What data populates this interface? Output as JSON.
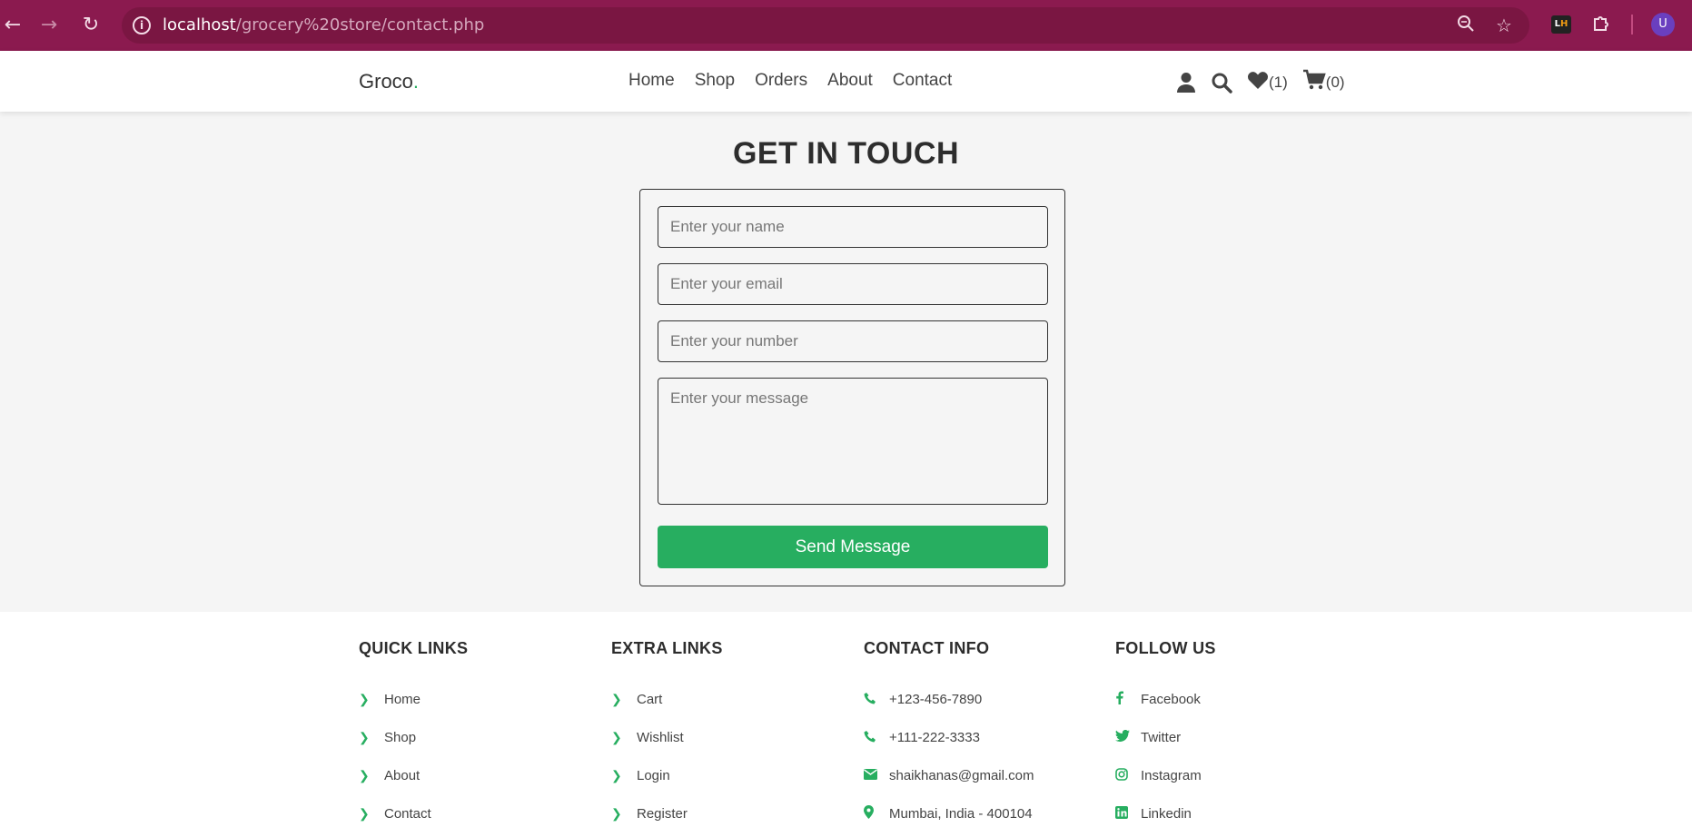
{
  "browser": {
    "url_host": "localhost",
    "url_path": "/grocery%20store/contact.php",
    "profile_initial": "U"
  },
  "header": {
    "logo": "Groco",
    "logo_dot": ".",
    "menu": [
      {
        "label": "Home"
      },
      {
        "label": "Shop"
      },
      {
        "label": "Orders"
      },
      {
        "label": "About"
      },
      {
        "label": "Contact"
      }
    ],
    "wishlist_count": "(1)",
    "cart_count": "(0)"
  },
  "contact": {
    "heading": "GET IN TOUCH",
    "name_placeholder": "Enter your name",
    "email_placeholder": "Enter your email",
    "number_placeholder": "Enter your number",
    "message_placeholder": "Enter your message",
    "send_label": "Send Message"
  },
  "footer": {
    "quick_links": {
      "title": "QUICK LINKS",
      "items": [
        "Home",
        "Shop",
        "About",
        "Contact"
      ]
    },
    "extra_links": {
      "title": "EXTRA LINKS",
      "items": [
        "Cart",
        "Wishlist",
        "Login",
        "Register"
      ]
    },
    "contact_info": {
      "title": "CONTACT INFO",
      "items": [
        {
          "icon": "phone-icon",
          "text": "+123-456-7890"
        },
        {
          "icon": "phone-icon",
          "text": "+111-222-3333"
        },
        {
          "icon": "envelope-icon",
          "text": "shaikhanas@gmail.com"
        },
        {
          "icon": "map-marker-icon",
          "text": "Mumbai, India - 400104"
        }
      ]
    },
    "follow_us": {
      "title": "FOLLOW US",
      "items": [
        {
          "icon": "facebook-icon",
          "text": "Facebook"
        },
        {
          "icon": "twitter-icon",
          "text": "Twitter"
        },
        {
          "icon": "instagram-icon",
          "text": "Instagram"
        },
        {
          "icon": "linkedin-icon",
          "text": "Linkedin"
        }
      ]
    }
  },
  "colors": {
    "accent": "#27ae60",
    "browser_bar": "#8b1a4f"
  }
}
